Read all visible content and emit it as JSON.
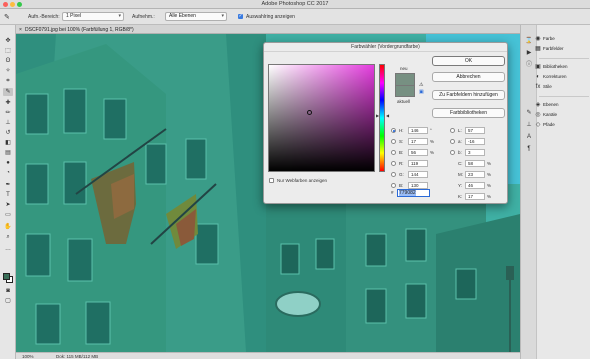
{
  "app": {
    "title": "Adobe Photoshop CC 2017"
  },
  "options_bar": {
    "sample_size_label": "Aufn.-Bereich:",
    "sample_size_value": "1 Pixel",
    "sample_label": "Aufnehm.:",
    "sample_value": "Alle Ebenen",
    "show_ring_label": "Auswahlring anzeigen"
  },
  "document": {
    "tab_title": "DSCF0791.jpg bei 100% (Farbfüllung 1, RGB/8*)"
  },
  "status_bar": {
    "zoom": "100%",
    "doc_info": "Dok: 115 MB/112 MB"
  },
  "panels": {
    "group1": [
      "Farbe",
      "Farbfelder"
    ],
    "group2": [
      "Bibliotheken",
      "Korrekturen",
      "Stile"
    ],
    "group3": [
      "Ebenen",
      "Kanäle",
      "Pfade"
    ]
  },
  "color_picker": {
    "title": "Farbwähler (Vordergrundfarbe)",
    "new_label": "neu",
    "current_label": "aktuell",
    "ok_label": "OK",
    "cancel_label": "Abbrechen",
    "add_swatch_label": "Zu Farbfeldern hinzufügen",
    "libraries_label": "Farbbibliotheken",
    "web_colors_label": "Nur Webfarben anzeigen",
    "hsb": {
      "H": {
        "value": "146",
        "unit": "°"
      },
      "S": {
        "value": "17",
        "unit": "%"
      },
      "B": {
        "value": "56",
        "unit": "%"
      }
    },
    "rgb": {
      "R": "119",
      "G": "144",
      "B": "130"
    },
    "lab": {
      "L": "57",
      "a": "-16",
      "b": "3"
    },
    "cmyk": {
      "C": {
        "value": "58",
        "unit": "%"
      },
      "M": {
        "value": "23",
        "unit": "%"
      },
      "Y": {
        "value": "46",
        "unit": "%"
      },
      "K": {
        "value": "17",
        "unit": "%"
      }
    },
    "hex": "779082",
    "selected_color": "#779082"
  },
  "colors": {
    "canvas_tint": "#3fb0a4",
    "foreground": "#3a6e58"
  }
}
